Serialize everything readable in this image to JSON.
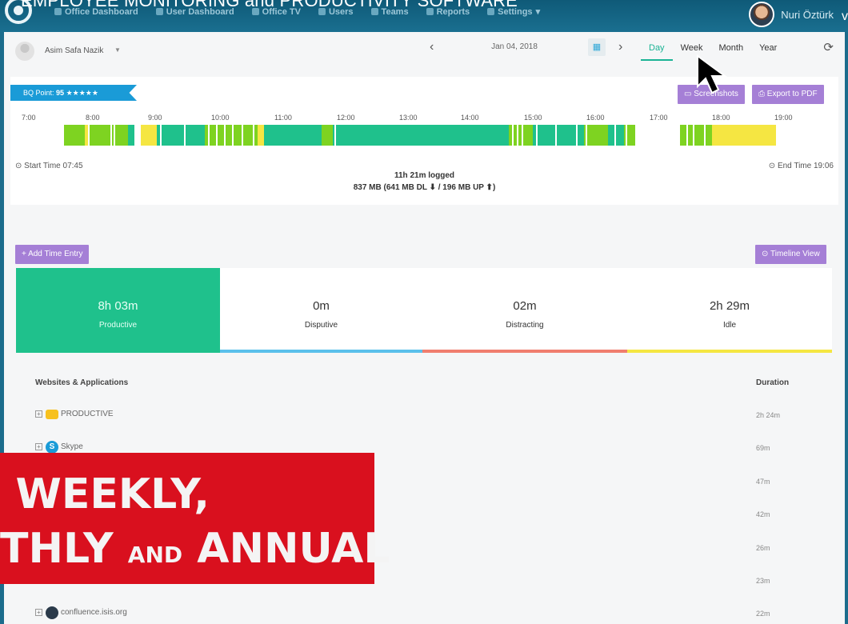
{
  "overlay_title": "EMPLOYEE MONITORING and PRODUCTIVITY SOFTWARE",
  "nav": [
    {
      "label": "Office Dashboard"
    },
    {
      "label": "User Dashboard"
    },
    {
      "label": "Office TV"
    },
    {
      "label": "Users"
    },
    {
      "label": "Teams"
    },
    {
      "label": "Reports"
    },
    {
      "label": "Settings"
    }
  ],
  "current_user": "Nuri Öztürk",
  "employee": {
    "name": "Asim Safa Nazik"
  },
  "date": {
    "value": "Jan 04, 2018"
  },
  "period_tabs": [
    {
      "label": "Day",
      "active": true
    },
    {
      "label": "Week",
      "active": false
    },
    {
      "label": "Month",
      "active": false
    },
    {
      "label": "Year",
      "active": false
    }
  ],
  "bq": {
    "label": "BQ Point:",
    "value": "95",
    "stars": "★★★★★"
  },
  "buttons": {
    "screenshots": "Screenshots",
    "export_pdf": "Export to PDF",
    "add_time_entry": "Add Time Entry",
    "timeline_view": "Timeline View"
  },
  "timeline": {
    "hours": [
      "7:00",
      "8:00",
      "9:00",
      "10:00",
      "11:00",
      "12:00",
      "13:00",
      "14:00",
      "15:00",
      "16:00",
      "17:00",
      "18:00",
      "19:00"
    ],
    "start_time": "Start Time 07:45",
    "end_time": "End Time 19:06",
    "logged": "11h 21m logged",
    "transfer": "837 MB (641 MB DL ⬇ / 196 MB UP ⬆)",
    "colors": {
      "productive": "#1fc18c",
      "distracting": "#f5e642",
      "idle_gap": "#ffffff",
      "mixed": "#7ed321"
    }
  },
  "stats": [
    {
      "value": "8h 03m",
      "label": "Productive",
      "color": "#1fc18c",
      "active": true
    },
    {
      "value": "0m",
      "label": "Disputive",
      "color": "#5bc0eb",
      "active": false
    },
    {
      "value": "02m",
      "label": "Distracting",
      "color": "#f07e6e",
      "active": false
    },
    {
      "value": "2h 29m",
      "label": "Idle",
      "color": "#f5e642",
      "active": false
    }
  ],
  "list": {
    "header_name": "Websites & Applications",
    "header_duration": "Duration",
    "rows": [
      {
        "name": "PRODUCTIVE",
        "duration": "2h 24m",
        "icon": "folder-icon"
      },
      {
        "name": "Skype",
        "duration": "69m",
        "icon": "skype-icon"
      },
      {
        "name": "",
        "duration": "47m",
        "icon": ""
      },
      {
        "name": "",
        "duration": "42m",
        "icon": ""
      },
      {
        "name": "",
        "duration": "26m",
        "icon": ""
      },
      {
        "name": "",
        "duration": "23m",
        "icon": ""
      },
      {
        "name": "confluence.isis.org",
        "duration": "22m",
        "icon": "confluence-icon"
      }
    ]
  },
  "promo": {
    "line1": "WEEKLY,",
    "line2_a": "THLY ",
    "line2_small": "AND",
    "line2_b": " ANNUAL"
  },
  "colors": {
    "accent": "#1ab394",
    "purple": "#a57fd6",
    "red_banner": "#d9101e",
    "ribbon": "#1a9bd7"
  }
}
